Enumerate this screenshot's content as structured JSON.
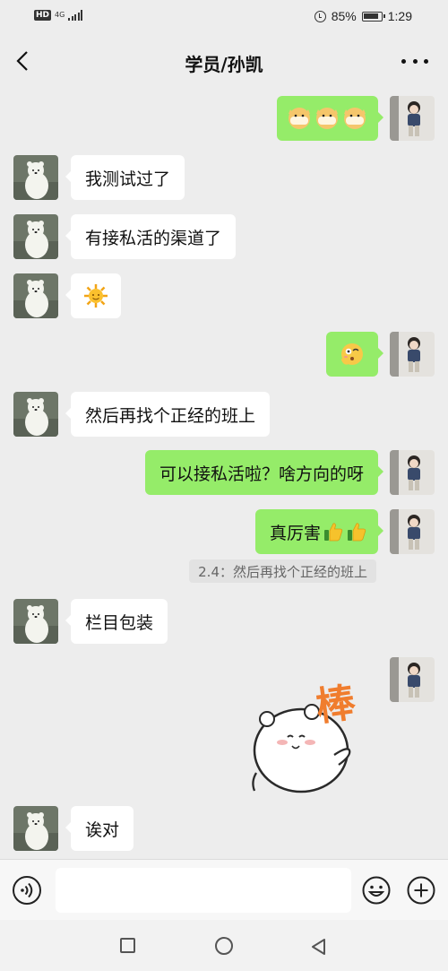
{
  "status_bar": {
    "hd": "HD",
    "network": "4G",
    "battery_percent": "85%",
    "time": "1:29"
  },
  "navbar": {
    "title": "学员/孙凯"
  },
  "messages": [
    {
      "side": "right",
      "kind": "emoji",
      "content": "doge x3"
    },
    {
      "side": "left",
      "kind": "text",
      "text": "我测试过了"
    },
    {
      "side": "left",
      "kind": "text",
      "text": "有接私活的渠道了"
    },
    {
      "side": "left",
      "kind": "emoji",
      "content": "sun"
    },
    {
      "side": "right",
      "kind": "emoji",
      "content": "shy face"
    },
    {
      "side": "left",
      "kind": "text",
      "text": "然后再找个正经的班上"
    },
    {
      "side": "right",
      "kind": "text",
      "text": "可以接私活啦？啥方向的呀"
    },
    {
      "side": "right",
      "kind": "text",
      "text": "真厉害",
      "suffix_icons": [
        "thumbs-up",
        "thumbs-up"
      ]
    },
    {
      "side": "right",
      "kind": "sticker",
      "sticker_text": "棒"
    },
    {
      "side": "left",
      "kind": "text",
      "text": "栏目包装"
    },
    {
      "side": "left",
      "kind": "text",
      "text": "诶对"
    }
  ],
  "quote": {
    "text": "2.4：然后再找个正经的班上"
  },
  "input_bar": {
    "placeholder": ""
  },
  "colors": {
    "background": "#ededed",
    "my_bubble": "#95ec69",
    "their_bubble": "#ffffff",
    "sticker_text": "#f07d2e"
  }
}
